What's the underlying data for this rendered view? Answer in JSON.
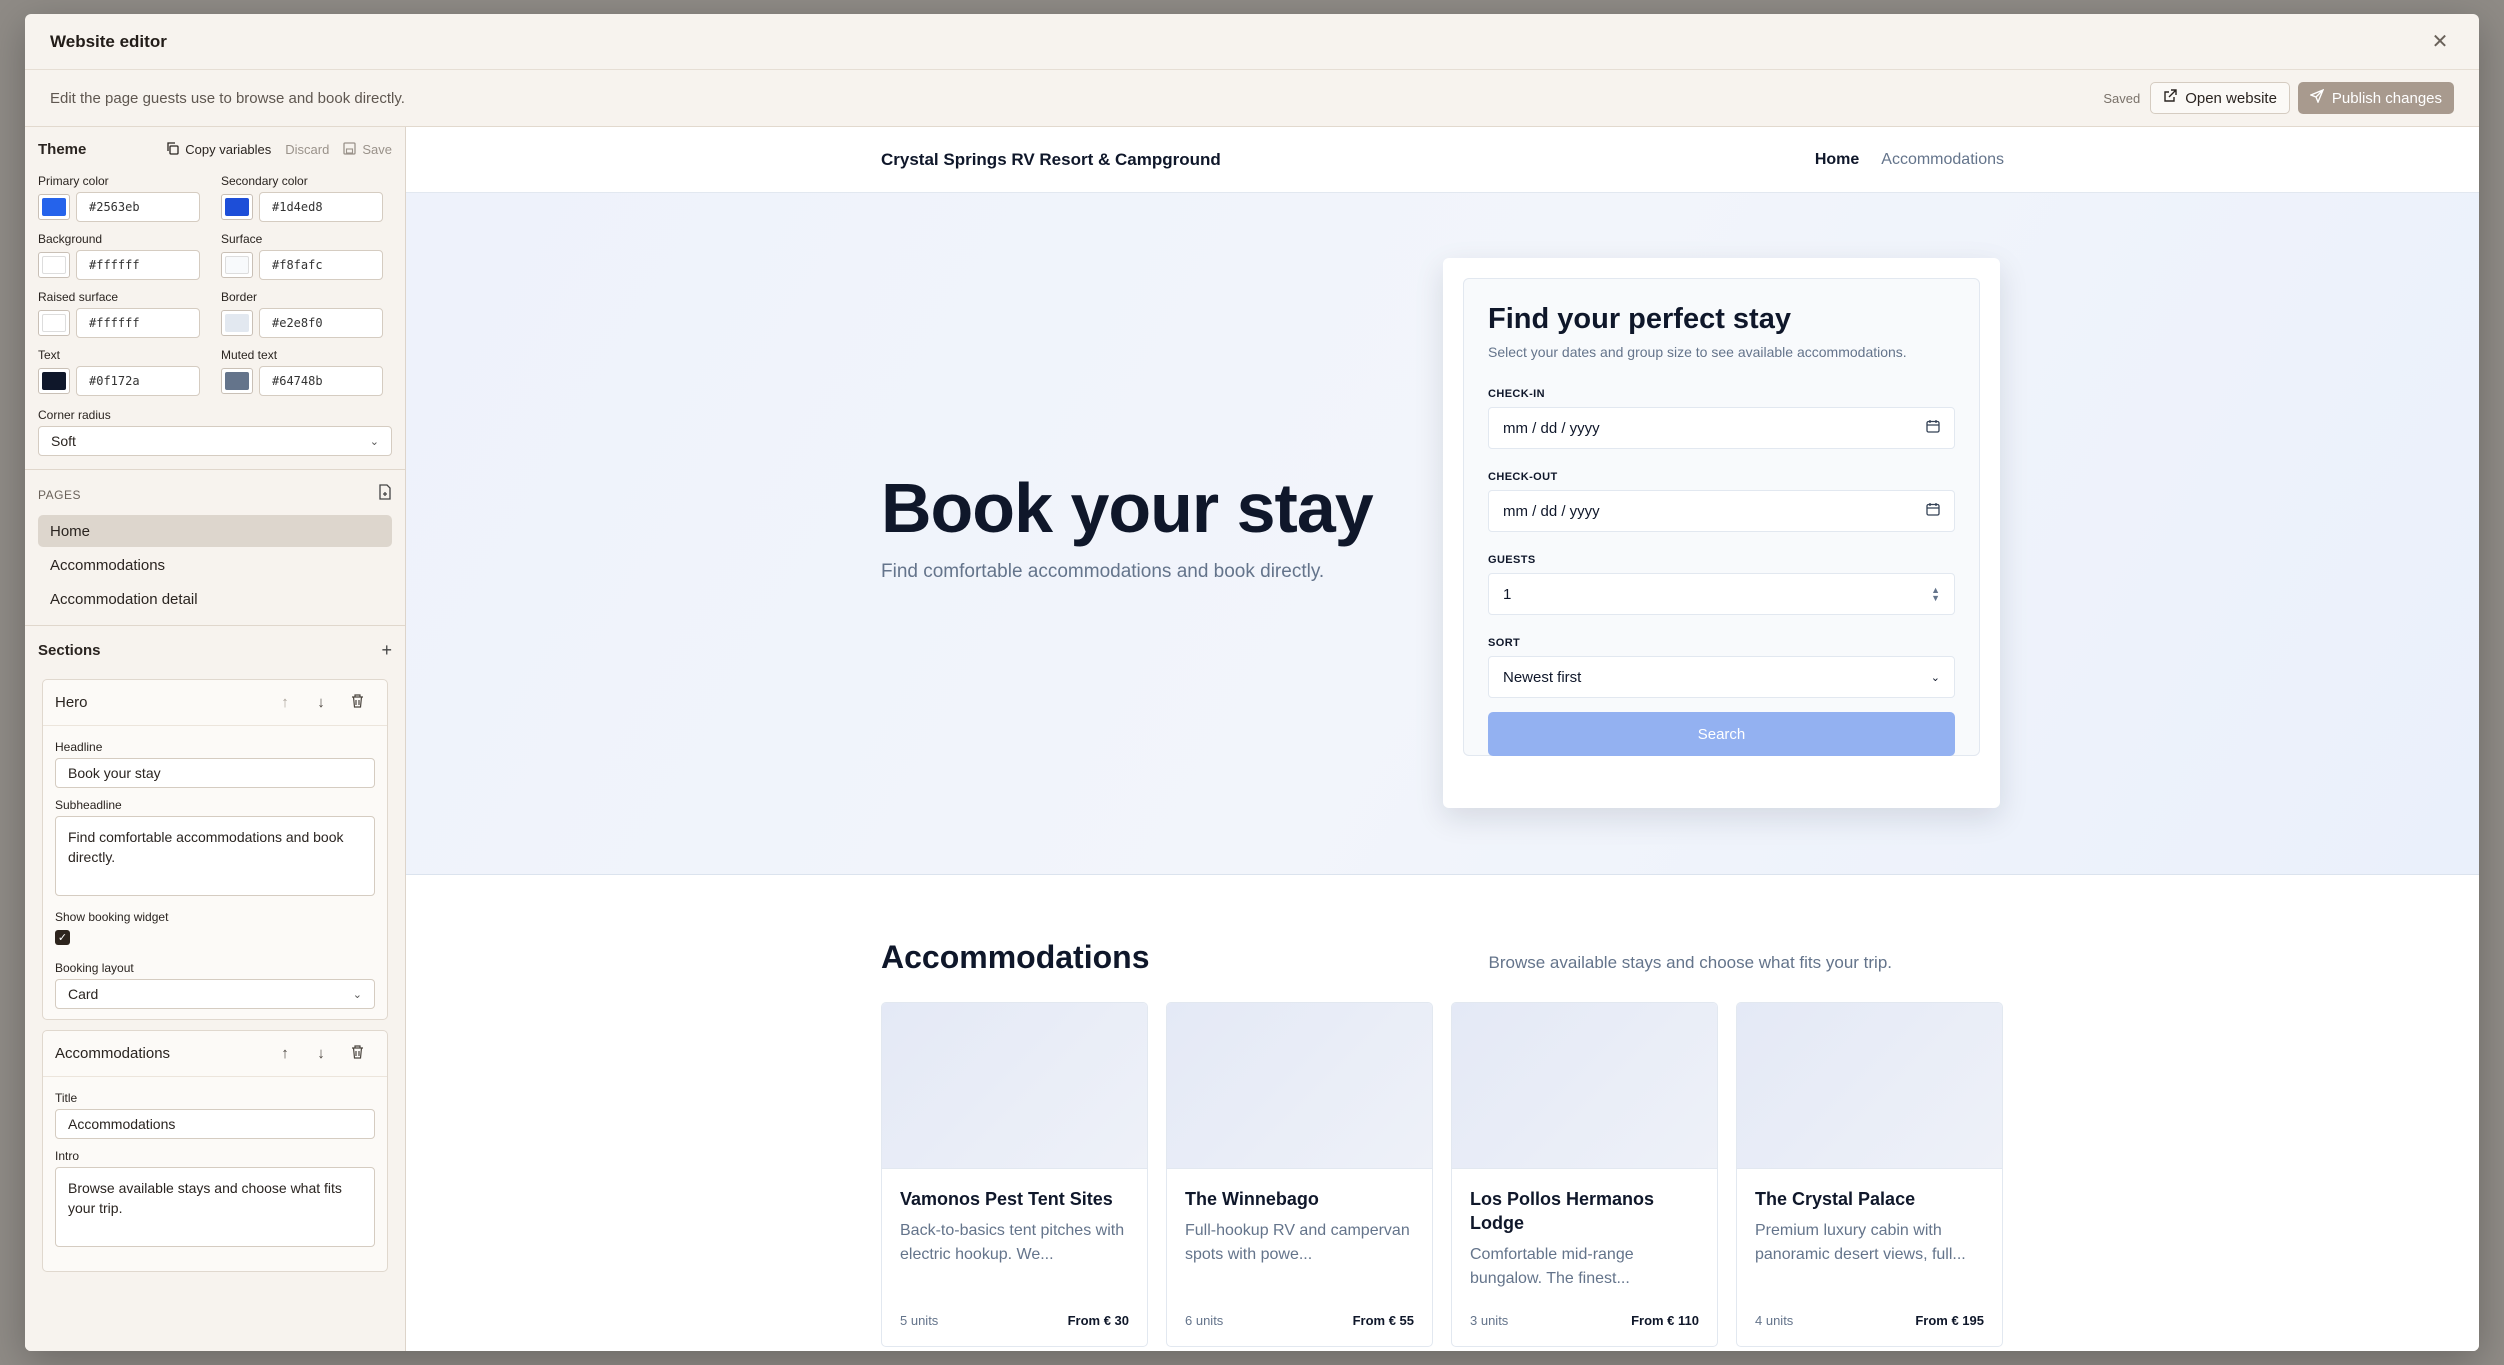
{
  "window": {
    "title": "Website editor"
  },
  "subbar": {
    "description": "Edit the page guests use to browse and book directly.",
    "saved": "Saved",
    "open_website": "Open website",
    "publish": "Publish changes"
  },
  "theme": {
    "heading": "Theme",
    "copy_variables": "Copy variables",
    "discard": "Discard",
    "save": "Save",
    "colors": [
      {
        "label": "Primary color",
        "value": "#2563eb"
      },
      {
        "label": "Secondary color",
        "value": "#1d4ed8"
      },
      {
        "label": "Background",
        "value": "#ffffff"
      },
      {
        "label": "Surface",
        "value": "#f8fafc"
      },
      {
        "label": "Raised surface",
        "value": "#ffffff"
      },
      {
        "label": "Border",
        "value": "#e2e8f0"
      },
      {
        "label": "Text",
        "value": "#0f172a"
      },
      {
        "label": "Muted text",
        "value": "#64748b"
      }
    ],
    "corner_radius_label": "Corner radius",
    "corner_radius": "Soft"
  },
  "pages": {
    "heading": "PAGES",
    "items": [
      "Home",
      "Accommodations",
      "Accommodation detail"
    ],
    "active": "Home"
  },
  "sections": {
    "heading": "Sections",
    "hero": {
      "title": "Hero",
      "headline_label": "Headline",
      "headline": "Book your stay",
      "subheadline_label": "Subheadline",
      "subheadline": "Find comfortable accommodations and book directly.",
      "show_widget_label": "Show booking widget",
      "layout_label": "Booking layout",
      "layout": "Card"
    },
    "accommodations": {
      "title": "Accommodations",
      "title_label": "Title",
      "title_value": "Accommodations",
      "intro_label": "Intro",
      "intro": "Browse available stays and choose what fits your trip."
    }
  },
  "site": {
    "brand": "Crystal Springs RV Resort & Campground",
    "nav": [
      "Home",
      "Accommodations"
    ],
    "hero_title": "Book your stay",
    "hero_sub": "Find comfortable accommodations and book directly.",
    "booking": {
      "title": "Find your perfect stay",
      "subtitle": "Select your dates and group size to see available accommodations.",
      "checkin_label": "CHECK-IN",
      "checkin_placeholder": "mm / dd / yyyy",
      "checkout_label": "CHECK-OUT",
      "checkout_placeholder": "mm / dd / yyyy",
      "guests_label": "GUESTS",
      "guests": "1",
      "sort_label": "SORT",
      "sort": "Newest first",
      "search": "Search"
    },
    "acc_title": "Accommodations",
    "acc_intro": "Browse available stays and choose what fits your trip.",
    "cards": [
      {
        "name": "Vamonos Pest Tent Sites",
        "desc": "Back-to-basics tent pitches with electric hookup. We...",
        "units": "5 units",
        "price": "From € 30"
      },
      {
        "name": "The Winnebago",
        "desc": "Full-hookup RV and campervan spots with powe...",
        "units": "6 units",
        "price": "From € 55"
      },
      {
        "name": "Los Pollos Hermanos Lodge",
        "desc": "Comfortable mid-range bungalow. The finest...",
        "units": "3 units",
        "price": "From € 110"
      },
      {
        "name": "The Crystal Palace",
        "desc": "Premium luxury cabin with panoramic desert views, full...",
        "units": "4 units",
        "price": "From € 195"
      }
    ]
  }
}
